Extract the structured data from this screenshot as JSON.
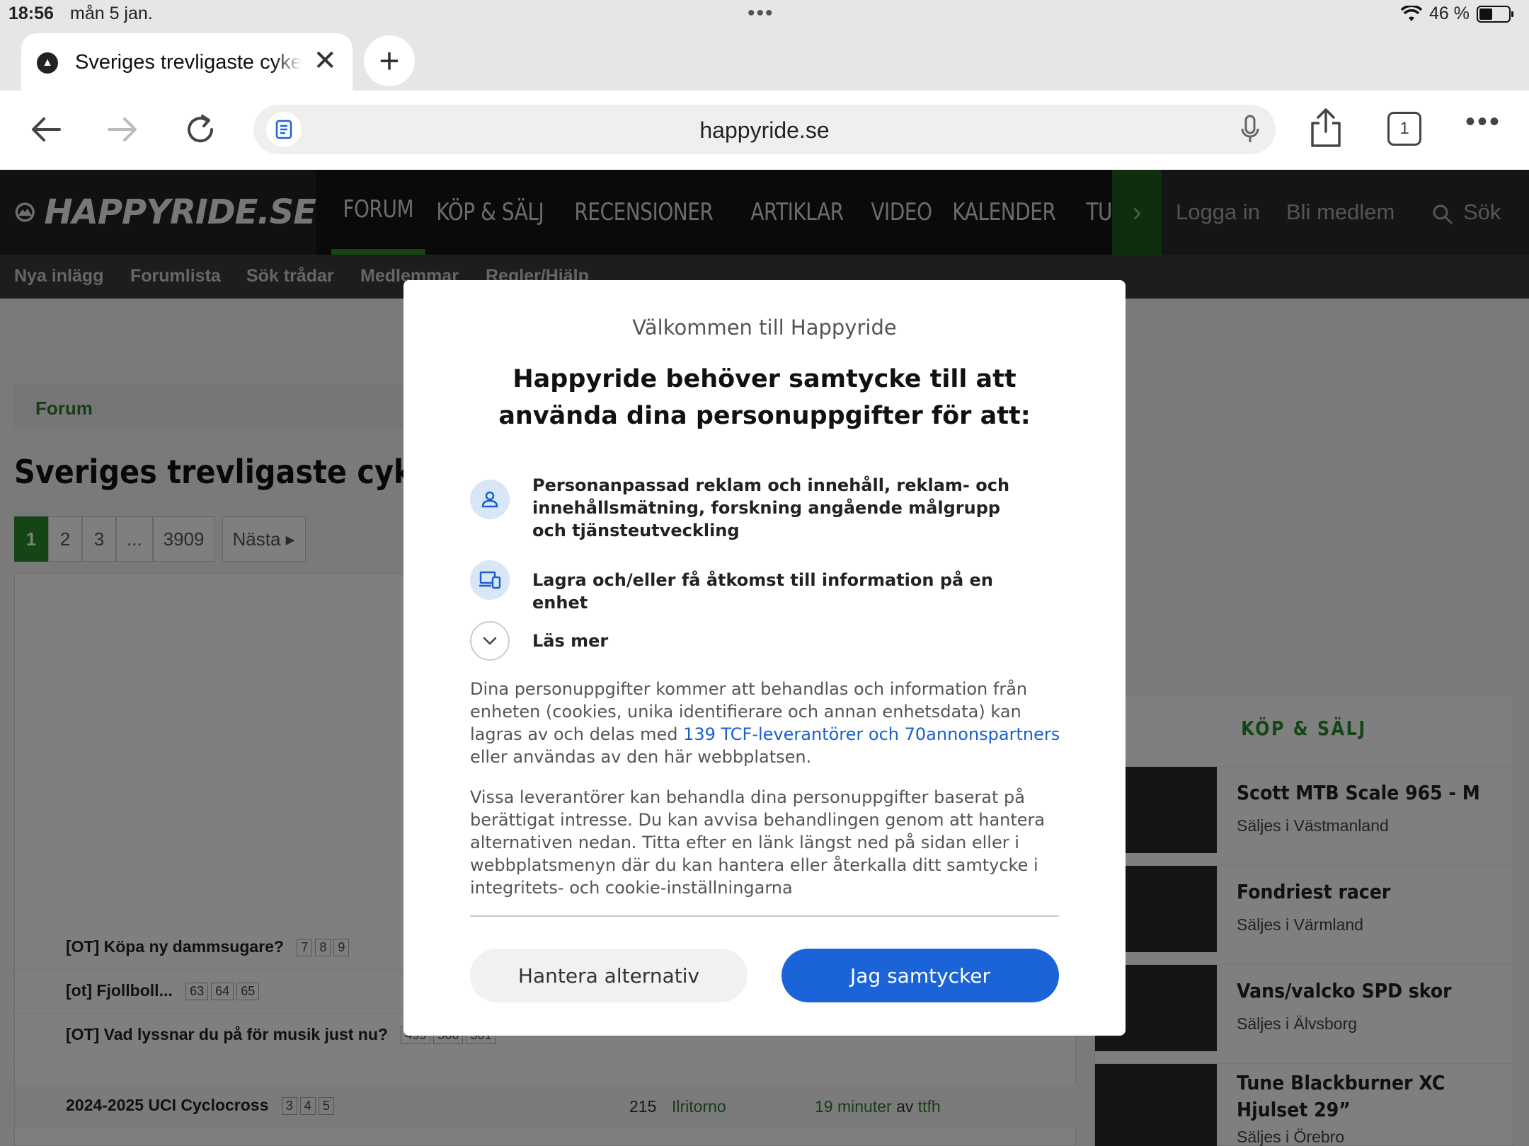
{
  "status_bar": {
    "time": "18:56",
    "date": "mån 5 jan.",
    "battery": "46 %"
  },
  "browser": {
    "tab_title": "Sveriges trevligaste cykelforum",
    "url": "happyride.se",
    "tabs_count": "1"
  },
  "site": {
    "logo": "HAPPYRIDE.SE",
    "nav": [
      "FORUM",
      "KÖP & SÄLJ",
      "RECENSIONER",
      "ARTIKLAR",
      "VIDEO",
      "KALENDER",
      "TURTIPS"
    ],
    "login": "Logga in",
    "register": "Bli medlem",
    "search": "Sök",
    "subnav": [
      "Nya inlägg",
      "Forumlista",
      "Sök trådar",
      "Medlemmar",
      "Regler/Hjälp"
    ],
    "breadcrumb": "Forum",
    "page_title": "Sveriges trevligaste cykelforum",
    "pager": [
      "1",
      "2",
      "3",
      "...",
      "3909"
    ],
    "pager_next": "Nästa",
    "threads": [
      {
        "title": "[OT] Köpa ny dammsugare?",
        "pages": [
          "7",
          "8",
          "9"
        ],
        "num": "",
        "user": "",
        "last_time": "",
        "last_user": ""
      },
      {
        "title": "[ot] Fjollboll...",
        "pages": [
          "63",
          "64",
          "65"
        ],
        "num": "",
        "user": "",
        "last_time": "",
        "last_user": ""
      },
      {
        "title": "[OT] Vad lyssnar du på för musik just nu?",
        "pages": [
          "499",
          "500",
          "501"
        ],
        "num": "",
        "user": "",
        "last_time": "",
        "last_user": ""
      },
      {
        "title": "2024-2025 UCI Cyclocross",
        "pages": [
          "3",
          "4",
          "5"
        ],
        "num": "215",
        "user": "Ilritorno",
        "last_time": "19 minuter",
        "last_by": "av",
        "last_user": "ttfh"
      }
    ],
    "market_heading": "KÖP & SÄLJ",
    "market": [
      {
        "title": "Scott MTB Scale 965 - M",
        "location": "Säljes i Västmanland"
      },
      {
        "title": "Fondriest racer",
        "location": "Säljes i Värmland"
      },
      {
        "title": "Vans/valcko SPD skor",
        "location": "Säljes i Älvsborg"
      },
      {
        "title": "Tune Blackburner XC Hjulset 29”",
        "location": "Säljes i Örebro"
      }
    ]
  },
  "consent": {
    "welcome": "Välkommen till Happyride",
    "heading": "Happyride behöver samtycke till att använda dina personuppgifter för att:",
    "purposes": [
      "Personanpassad reklam och innehåll, reklam- och innehållsmätning, forskning angående målgrupp och tjänsteutveckling",
      "Lagra och/eller få åtkomst till information på en enhet"
    ],
    "read_more": "Läs mer",
    "para1_a": "Dina personuppgifter kommer att behandlas och information från enheten (cookies, unika identifierare och annan enhetsdata) kan lagras av och delas med ",
    "para1_link": "139 TCF-leverantörer och 70annonspartners",
    "para1_b": " eller användas av den här webbplatsen.",
    "para2": "Vissa leverantörer kan behandla dina personuppgifter baserat på berättigat intresse. Du kan avvisa behandlingen genom att hantera alternativen nedan. Titta efter en länk längst ned på sidan eller i webbplatsmenyn där du kan hantera eller återkalla ditt samtycke i integritets- och cookie-inställningarna",
    "manage_button": "Hantera alternativ",
    "accept_button": "Jag samtycker"
  }
}
